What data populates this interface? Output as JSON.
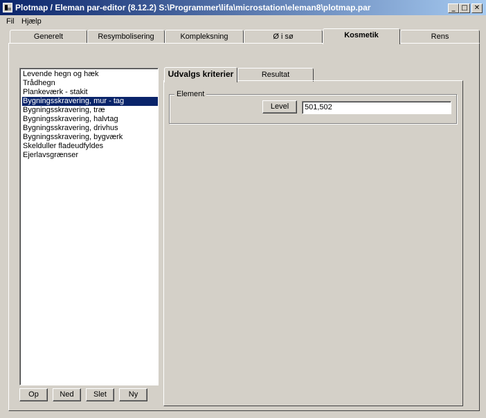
{
  "window": {
    "title": "Plotmap / Eleman par-editor (8.12.2) S:\\Programmer\\lifa\\microstation\\eleman8\\plotmap.par",
    "buttons": {
      "minimize": "_",
      "maximize": "□",
      "close": "✕"
    }
  },
  "menu": [
    "Fil",
    "Hjælp"
  ],
  "tabs": [
    "Generelt",
    "Resymbolisering",
    "Kompleksning",
    "Ø i sø",
    "Kosmetik",
    "Rens"
  ],
  "active_tab": "Kosmetik",
  "list": {
    "items": [
      "Levende hegn og hæk",
      "Trådhegn",
      "Plankeværk - stakit",
      "Bygningsskravering, mur - tag",
      "Bygningsskravering, træ",
      "Bygningsskravering, halvtag",
      "Bygningsskravering, drivhus",
      "Bygningsskravering, bygværk",
      "Skelduller fladeudfyldes",
      "Ejerlavsgrænser"
    ],
    "selected": "Bygningsskravering, mur - tag"
  },
  "list_buttons": [
    "Op",
    "Ned",
    "Slet",
    "Ny"
  ],
  "inner_tabs": [
    "Udvalgs kriterier",
    "Resultat"
  ],
  "active_inner_tab": "Udvalgs kriterier",
  "element_group": {
    "label": "Element",
    "level_button": "Level",
    "level_value": "501,502"
  }
}
